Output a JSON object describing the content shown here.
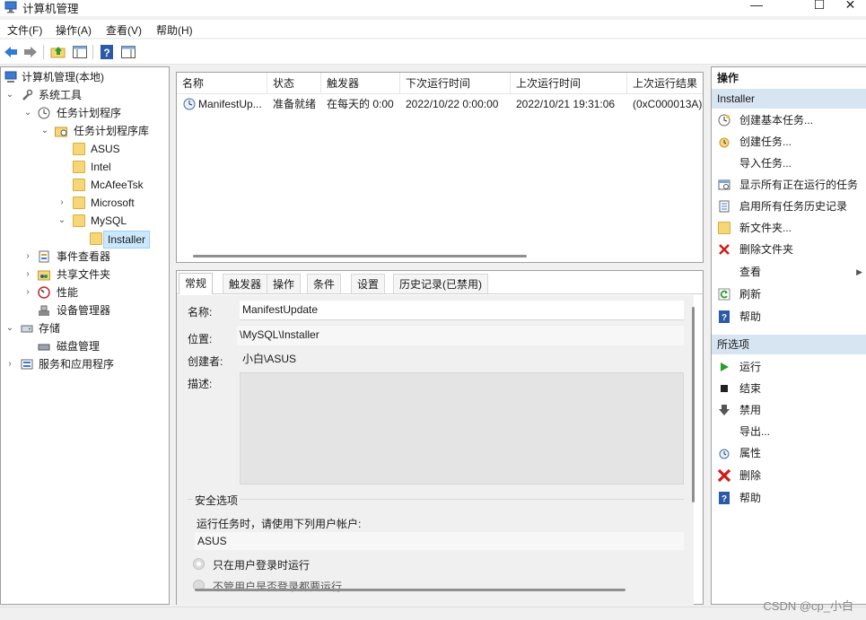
{
  "window": {
    "title": "计算机管理",
    "minimize": "—",
    "maximize": "☐",
    "close": "✕"
  },
  "menu": [
    "文件(F)",
    "操作(A)",
    "查看(V)",
    "帮助(H)"
  ],
  "toolbar_icons": [
    "back-arrow-icon",
    "forward-arrow-icon",
    "folder-up-icon",
    "show-hide-tree-icon",
    "help-icon",
    "properties-pane-icon"
  ],
  "tree": {
    "root": "计算机管理(本地)",
    "system_tools": "系统工具",
    "task_scheduler": "任务计划程序",
    "task_library": "任务计划程序库",
    "asus": "ASUS",
    "intel": "Intel",
    "mcafee": "McAfeeTsk",
    "microsoft": "Microsoft",
    "mysql": "MySQL",
    "installer": "Installer",
    "event_viewer": "事件查看器",
    "shared_folders": "共享文件夹",
    "performance": "性能",
    "device_manager": "设备管理器",
    "storage": "存储",
    "disk_management": "磁盘管理",
    "services_apps": "服务和应用程序"
  },
  "task_list": {
    "columns": [
      "名称",
      "状态",
      "触发器",
      "下次运行时间",
      "上次运行时间",
      "上次运行结果"
    ],
    "rows": [
      [
        "ManifestUp...",
        "准备就绪",
        "在每天的 0:00",
        "2022/10/22 0:00:00",
        "2022/10/21 19:31:06",
        "(0xC000013A)"
      ]
    ]
  },
  "details": {
    "tabs": [
      "常规",
      "触发器",
      "操作",
      "条件",
      "设置",
      "历史记录(已禁用)"
    ],
    "name_label": "名称:",
    "name_value": "ManifestUpdate",
    "location_label": "位置:",
    "location_value": "\\MySQL\\Installer",
    "author_label": "创建者:",
    "author_value": "小白\\ASUS",
    "description_label": "描述:",
    "security_title": "安全选项",
    "security_prompt": "运行任务时，请使用下列用户帐户:",
    "security_user": "ASUS",
    "radio_logged_on": "只在用户登录时运行",
    "radio_whether": "不管用户是否登录都要运行"
  },
  "actions": {
    "header": "操作",
    "section1": "Installer",
    "items1": [
      "创建基本任务...",
      "创建任务...",
      "导入任务...",
      "显示所有正在运行的任务",
      "启用所有任务历史记录",
      "新文件夹...",
      "删除文件夹",
      "查看",
      "刷新",
      "帮助"
    ],
    "section2": "所选项",
    "items2": [
      "运行",
      "结束",
      "禁用",
      "导出...",
      "属性",
      "删除",
      "帮助"
    ]
  },
  "watermark": "CSDN @cp_小白",
  "colors": {
    "section_header_bg": "#d7e4f2",
    "selection_bg": "#cce8ff",
    "folder": "#f7d67a",
    "help_blue": "#2b5aa8",
    "delete_red": "#d11a1a",
    "run_green": "#2a9d2a"
  }
}
